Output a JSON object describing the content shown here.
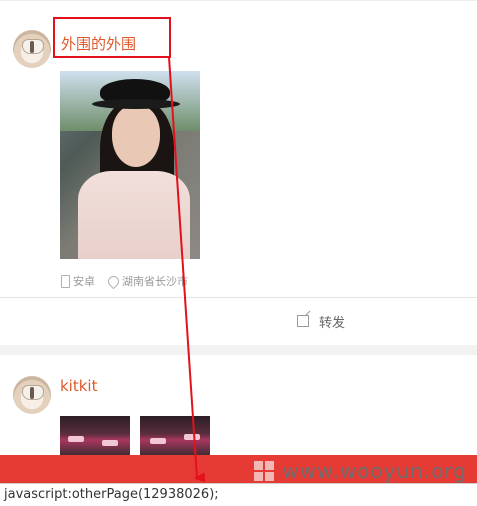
{
  "posts": [
    {
      "username": "外围的外围",
      "device": "安卓",
      "location": "湖南省长沙市",
      "repost_label": "转发"
    },
    {
      "username": "kitkit"
    }
  ],
  "watermark": {
    "text": "www.wooyun.org"
  },
  "status_bar": {
    "text": "javascript:otherPage(12938026);"
  },
  "colors": {
    "username": "#e0592a",
    "highlight": "#e3111b",
    "bar": "#e63b35"
  }
}
